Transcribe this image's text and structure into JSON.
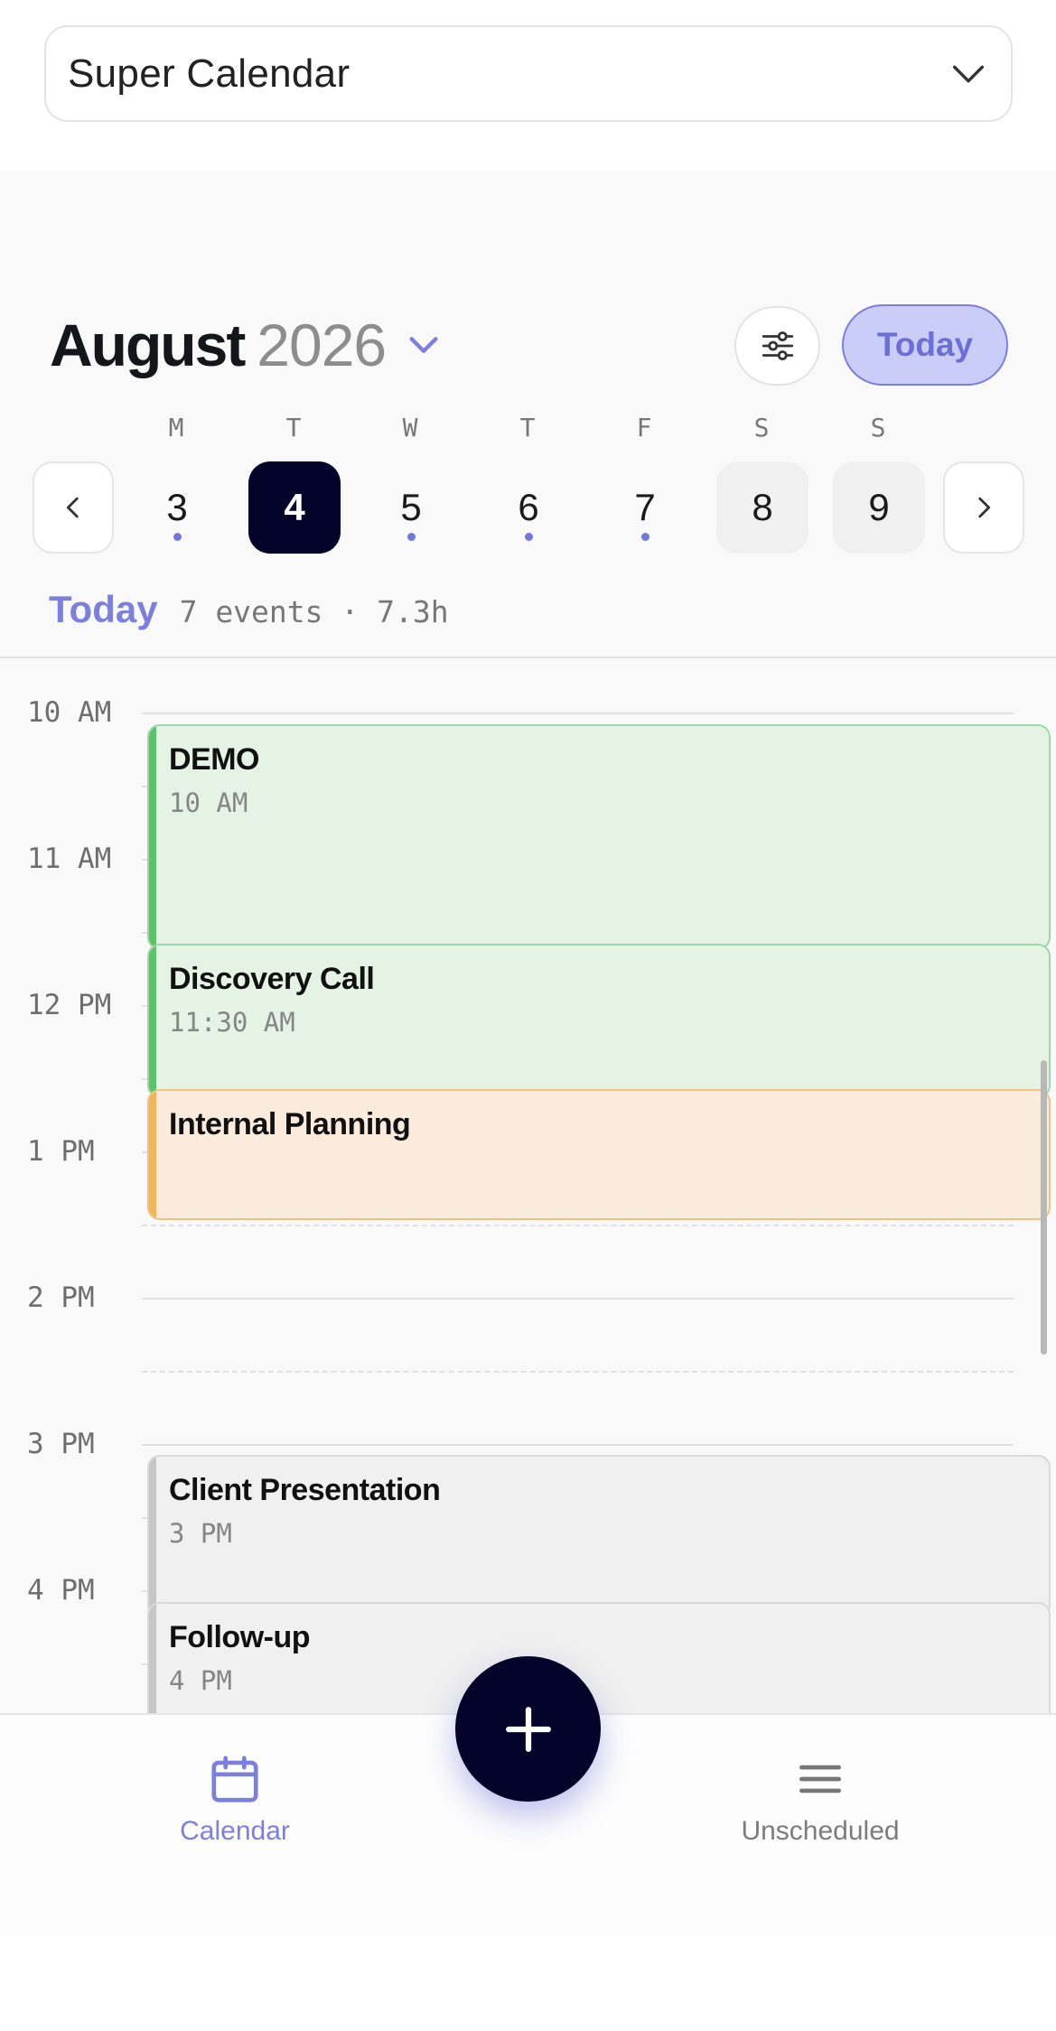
{
  "calendar_select": {
    "value": "Super Calendar"
  },
  "header": {
    "month": "August",
    "year": "2026",
    "today_button": "Today"
  },
  "week": {
    "days": [
      {
        "dow": "M",
        "date": "3",
        "has_events": true,
        "selected": false,
        "weekend": false
      },
      {
        "dow": "T",
        "date": "4",
        "has_events": false,
        "selected": true,
        "weekend": false
      },
      {
        "dow": "W",
        "date": "5",
        "has_events": true,
        "selected": false,
        "weekend": false
      },
      {
        "dow": "T",
        "date": "6",
        "has_events": true,
        "selected": false,
        "weekend": false
      },
      {
        "dow": "F",
        "date": "7",
        "has_events": true,
        "selected": false,
        "weekend": false
      },
      {
        "dow": "S",
        "date": "8",
        "has_events": false,
        "selected": false,
        "weekend": true
      },
      {
        "dow": "S",
        "date": "9",
        "has_events": false,
        "selected": false,
        "weekend": true
      }
    ]
  },
  "day_summary": {
    "label": "Today",
    "text": "7 events · 7.3h"
  },
  "timeline": {
    "hours": [
      "10 AM",
      "11 AM",
      "12 PM",
      "1 PM",
      "2 PM",
      "3 PM",
      "4 PM"
    ],
    "events": [
      {
        "title": "DEMO",
        "time": "10 AM",
        "color": "green"
      },
      {
        "title": "Discovery Call",
        "time": "11:30 AM",
        "color": "green"
      },
      {
        "title": "Internal Planning",
        "time": "",
        "color": "orange"
      },
      {
        "title": "Client Presentation",
        "time": "3 PM",
        "color": "gray"
      },
      {
        "title": "Follow-up",
        "time": "4 PM",
        "color": "gray"
      }
    ]
  },
  "tabs": {
    "calendar": "Calendar",
    "unscheduled": "Unscheduled"
  },
  "colors": {
    "accent": "#7a7fe0",
    "dark": "#04042a",
    "green": "#5cc26c",
    "orange": "#f2b55a",
    "gray": "#c6c6c6"
  }
}
